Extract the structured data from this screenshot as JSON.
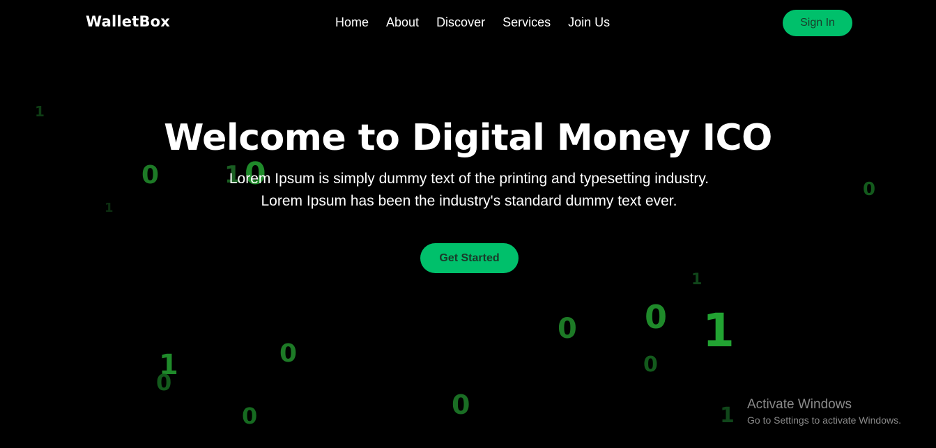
{
  "brand": {
    "logo_text": "WalletBox"
  },
  "nav": {
    "items": [
      {
        "label": "Home"
      },
      {
        "label": "About"
      },
      {
        "label": "Discover"
      },
      {
        "label": "Services"
      },
      {
        "label": "Join Us"
      }
    ],
    "signin_label": "Sign In"
  },
  "hero": {
    "title": "Welcome to Digital Money ICO",
    "description": "Lorem Ipsum is simply dummy text of the printing and typesetting industry. Lorem Ipsum has been the industry's standard dummy text ever.",
    "cta_label": "Get Started"
  },
  "background_digits": [
    "1",
    "0",
    "1",
    "0",
    "1",
    "0",
    "1",
    "0",
    "0",
    "0",
    "0",
    "1",
    "0",
    "1",
    "0",
    "0",
    "1"
  ],
  "watermark": {
    "title": "Activate Windows",
    "subtitle": "Go to Settings to activate Windows."
  },
  "colors": {
    "background": "#000000",
    "accent": "#00c06b",
    "accent_text": "#1a3a2a",
    "digit_green": "#1f8a2a"
  }
}
